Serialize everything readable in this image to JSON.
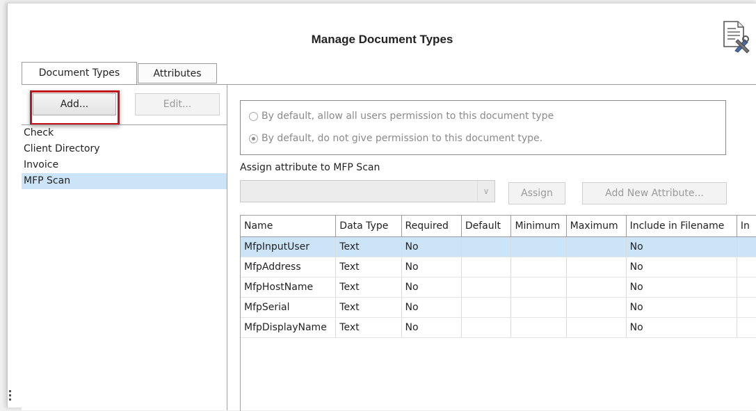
{
  "window": {
    "title": "Manage Document Types"
  },
  "tabs": [
    {
      "label": "Document Types",
      "active": true
    },
    {
      "label": "Attributes",
      "active": false
    }
  ],
  "left": {
    "add_label": "Add...",
    "edit_label": "Edit...",
    "document_types": [
      "Check",
      "Client Directory",
      "Invoice",
      "MFP Scan"
    ],
    "selected": "MFP Scan"
  },
  "permissions": {
    "allow_all_label": "By default, allow all users permission to this document type",
    "deny_label": "By default, do not give permission to this document type.",
    "selected": "deny"
  },
  "assign": {
    "label": "Assign attribute to MFP Scan",
    "combo_value": "",
    "assign_label": "Assign",
    "add_new_label": "Add New Attribute..."
  },
  "grid": {
    "columns": [
      "Name",
      "Data Type",
      "Required",
      "Default",
      "Minimum",
      "Maximum",
      "Include in Filename",
      "In"
    ],
    "rows": [
      [
        "MfpInputUser",
        "Text",
        "No",
        "",
        "",
        "",
        "No",
        ""
      ],
      [
        "MfpAddress",
        "Text",
        "No",
        "",
        "",
        "",
        "No",
        ""
      ],
      [
        "MfpHostName",
        "Text",
        "No",
        "",
        "",
        "",
        "No",
        ""
      ],
      [
        "MfpSerial",
        "Text",
        "No",
        "",
        "",
        "",
        "No",
        ""
      ],
      [
        "MfpDisplayName",
        "Text",
        "No",
        "",
        "",
        "",
        "No",
        ""
      ]
    ],
    "selected_row": 0
  },
  "icons": {
    "title_icon": "document-settings-icon",
    "grip": "resize-grip-icon"
  }
}
